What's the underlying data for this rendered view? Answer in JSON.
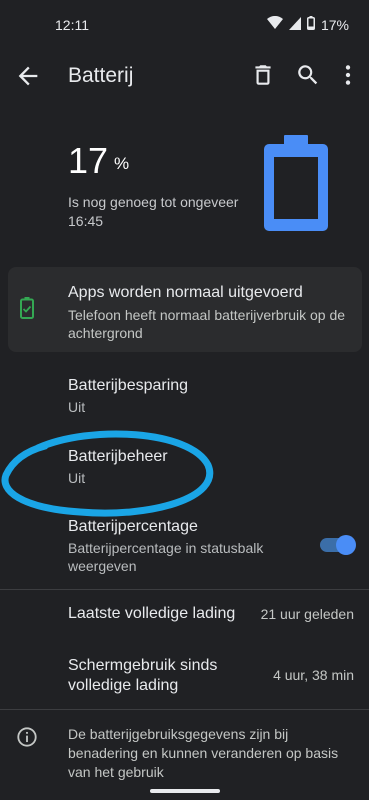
{
  "status": {
    "time": "12:11",
    "battery": "17%"
  },
  "appbar": {
    "title": "Batterij"
  },
  "hero": {
    "percent": "17",
    "unit": "%",
    "subtitle": "Is nog genoeg tot ongeveer 16:45",
    "level": 0.17
  },
  "card": {
    "title": "Apps worden normaal uitgevoerd",
    "subtitle": "Telefoon heeft normaal batterijverbruik op de achtergrond"
  },
  "settings": [
    {
      "title": "Batterijbesparing",
      "subtitle": "Uit"
    },
    {
      "title": "Batterijbeheer",
      "subtitle": "Uit"
    },
    {
      "title": "Batterijpercentage",
      "subtitle": "Batterijpercentage in statusbalk weergeven",
      "toggle": true
    }
  ],
  "stats": [
    {
      "label": "Laatste volledige lading",
      "value": "21 uur geleden"
    },
    {
      "label": "Schermgebruik sinds volledige lading",
      "value": "4 uur, 38 min"
    }
  ],
  "footer": {
    "text": "De batterijgebruiksgegevens zijn bij benadering en kunnen veranderen op basis van het gebruik"
  },
  "colors": {
    "background": "#202124",
    "accent": "#4a8df6",
    "battery_good": "#34a853",
    "annotation": "#1aa5e6"
  },
  "icons": [
    "back-arrow-icon",
    "trash-icon",
    "search-icon",
    "more-vert-icon",
    "wifi-icon",
    "signal-icon",
    "battery-icon",
    "battery-check-icon",
    "info-icon"
  ]
}
